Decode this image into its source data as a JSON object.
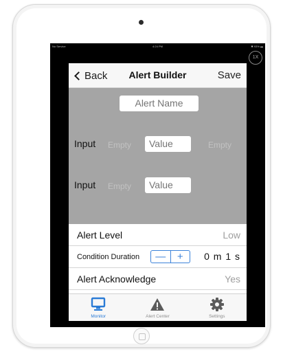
{
  "status_bar": {
    "carrier": "No Service",
    "time": "4:24 PM",
    "battery": "✱ 93% ▬"
  },
  "zoom_badge": "1X",
  "nav": {
    "back_label": "Back",
    "title": "Alert Builder",
    "save_label": "Save"
  },
  "builder": {
    "alert_name_placeholder": "Alert Name",
    "input_rows": [
      {
        "label": "Input",
        "left_value": "Empty",
        "value_placeholder": "Value",
        "right_value": "Empty"
      },
      {
        "label": "Input",
        "left_value": "Empty",
        "value_placeholder": "Value"
      }
    ]
  },
  "settings": {
    "alert_level": {
      "label": "Alert Level",
      "value": "Low"
    },
    "condition_duration": {
      "label": "Condition Duration",
      "minus": "—",
      "plus": "+",
      "value": "0 m 1 s"
    },
    "alert_acknowledge": {
      "label": "Alert Acknowledge",
      "value": "Yes"
    }
  },
  "tabs": [
    {
      "label": "Monitor",
      "icon": "monitor-icon",
      "active": true
    },
    {
      "label": "Alert Center",
      "icon": "warning-icon",
      "active": false
    },
    {
      "label": "Settings",
      "icon": "gear-icon",
      "active": false
    }
  ],
  "colors": {
    "accent": "#2a7bd6",
    "builder_background": "#a5a5a5",
    "inactive_tab": "#5b5b5b"
  }
}
